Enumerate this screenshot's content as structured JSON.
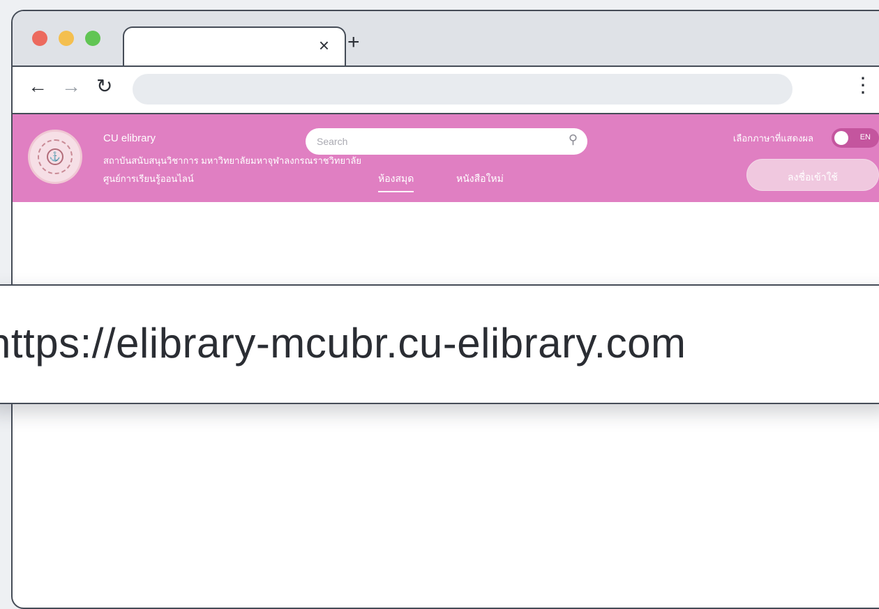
{
  "browser": {
    "tab_close_icon": "×",
    "new_tab_icon": "+",
    "back_icon": "←",
    "forward_icon": "→",
    "reload_icon": "↻",
    "menu_icon": "⋮",
    "traffic_lights": {
      "close": "#ec6a5e",
      "minimize": "#f4bf4f",
      "maximize": "#61c554"
    }
  },
  "site": {
    "header_color": "#e07fc2",
    "brand_name": "CU elibrary",
    "brand_line_1": "สถาบันสนับสนุนวิชาการ มหาวิทยาลัยมหาจุฬาลงกรณราชวิทยาลัย",
    "brand_line_2": "ศูนย์การเรียนรู้ออนไลน์",
    "search_placeholder": "Search",
    "nav": [
      "ห้องสมุด",
      "หนังสือใหม่"
    ],
    "lang_label": "เลือกภาษาที่แสดงผล",
    "toggle_label": "EN",
    "login_label": "ลงชื่อเข้าใช้"
  },
  "callout": {
    "url": "https://elibrary-mcubr.cu-elibrary.com"
  }
}
